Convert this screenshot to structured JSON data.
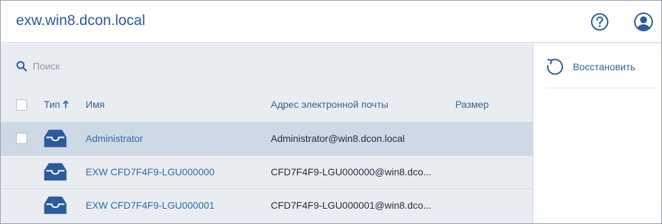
{
  "header": {
    "title": "exw.win8.dcon.local",
    "help_icon": "question-circle-icon",
    "account_icon": "user-avatar-icon"
  },
  "search": {
    "placeholder": "Поиск",
    "value": "",
    "icon": "search-icon"
  },
  "table": {
    "columns": [
      {
        "key": "type",
        "label": "Тип",
        "sort": "ascending"
      },
      {
        "key": "name",
        "label": "Имя"
      },
      {
        "key": "email",
        "label": "Адрес электронной почты"
      },
      {
        "key": "size",
        "label": "Размер"
      }
    ],
    "rows": [
      {
        "icon": "mailbox-icon",
        "name": "Administrator",
        "email": "Administrator@win8.dcon.local",
        "size": "",
        "selected": true,
        "checked": false
      },
      {
        "icon": "mailbox-icon",
        "name": "EXW CFD7F4F9-LGU000000",
        "email": "CFD7F4F9-LGU000000@win8.dco...",
        "size": "",
        "selected": false,
        "checked": false
      },
      {
        "icon": "mailbox-icon",
        "name": "EXW CFD7F4F9-LGU000001",
        "email": "CFD7F4F9-LGU000001@win8.dco...",
        "size": "",
        "selected": false,
        "checked": false
      }
    ]
  },
  "side_panel": {
    "actions": [
      {
        "label": "Восстановить",
        "icon": "restore-icon"
      }
    ]
  },
  "colors": {
    "accent": "#2c5a9a",
    "link": "#2f6aa6",
    "list_background": "#e9edf2",
    "selected_row": "#cfd9e6"
  }
}
